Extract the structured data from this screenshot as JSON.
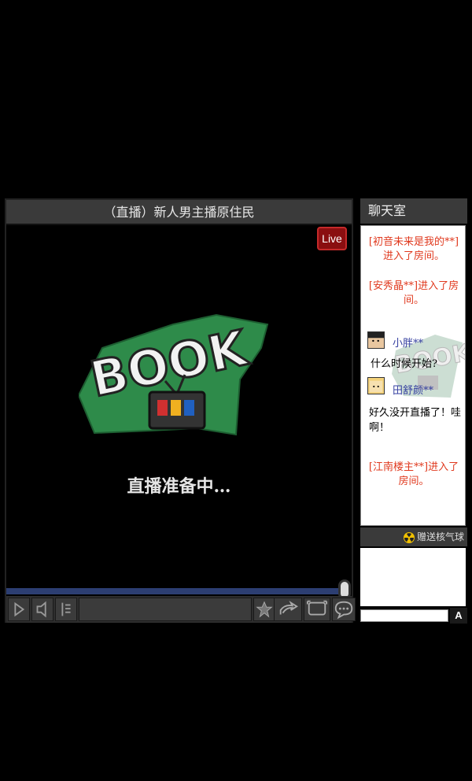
{
  "player": {
    "title": "（直播）新人男主播原住民",
    "live_badge": "Live",
    "status_text": "直播准备中…",
    "logo_text": "BOOK",
    "progress": 1.0
  },
  "controls": {
    "icons": [
      "play-icon",
      "volume-icon",
      "playlist-icon",
      "favorite-icon",
      "share-icon",
      "fullscreen-icon",
      "danmaku-icon"
    ]
  },
  "chat": {
    "title": "聊天室",
    "messages": [
      {
        "type": "system",
        "text": "[初音未来是我的**]进入了房间。"
      },
      {
        "type": "system",
        "text": "[安秀晶**]进入了房间。"
      },
      {
        "type": "user",
        "name": "小胖**",
        "text": "什么时候开始?"
      },
      {
        "type": "user",
        "name": "田舒颜**",
        "text": "好久没开直播了！哇啊！"
      },
      {
        "type": "system",
        "text": "[江南楼主**]进入了房间。"
      }
    ],
    "gift_label": "赠送核气球",
    "send_label": "A"
  },
  "colors": {
    "system_text": "#e0391e",
    "username": "#3540a0",
    "logo_green": "#2e8b4a",
    "progress": "#2c3e72",
    "live_badge": "#8a0e10"
  }
}
